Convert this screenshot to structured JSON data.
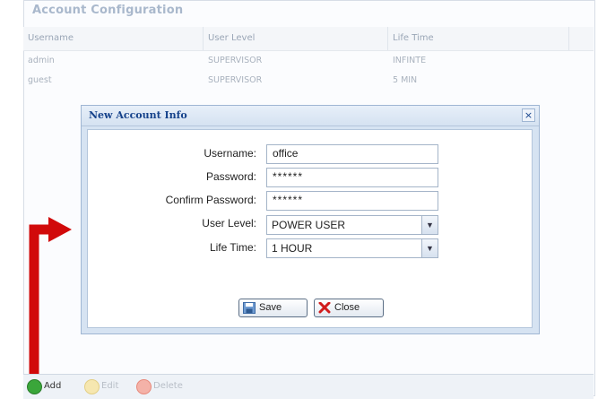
{
  "panel": {
    "title": "Account Configuration"
  },
  "grid": {
    "columns": [
      "Username",
      "User Level",
      "Life Time"
    ],
    "rows": [
      [
        "admin",
        "SUPERVISOR",
        "INFINTE"
      ],
      [
        "guest",
        "SUPERVISOR",
        "5 MIN"
      ]
    ]
  },
  "dialog": {
    "title": "New Account Info",
    "close_glyph": "×",
    "username_label": "Username:",
    "username_value": "office",
    "password_label": "Password:",
    "password_value": "******",
    "confirm_label": "Confirm Password:",
    "confirm_value": "******",
    "level_label": "User Level:",
    "level_value": "POWER USER",
    "lifetime_label": "Life Time:",
    "lifetime_value": "1 HOUR",
    "save_label": "Save",
    "close_label": "Close"
  },
  "toolbar": {
    "add_label": "Add",
    "edit_label": "Edit",
    "delete_label": "Delete"
  },
  "colors": {
    "annotation_arrow": "#d10a0a",
    "dialog_title": "#15428b",
    "add_icon": "#3aa63a",
    "edit_icon": "#f3d36b",
    "delete_icon": "#ee7a6a"
  },
  "icons": {
    "add": "plus-circle-icon",
    "edit": "pencil-icon",
    "delete": "minus-circle-icon",
    "save": "floppy-disk-icon",
    "close": "red-x-icon"
  }
}
